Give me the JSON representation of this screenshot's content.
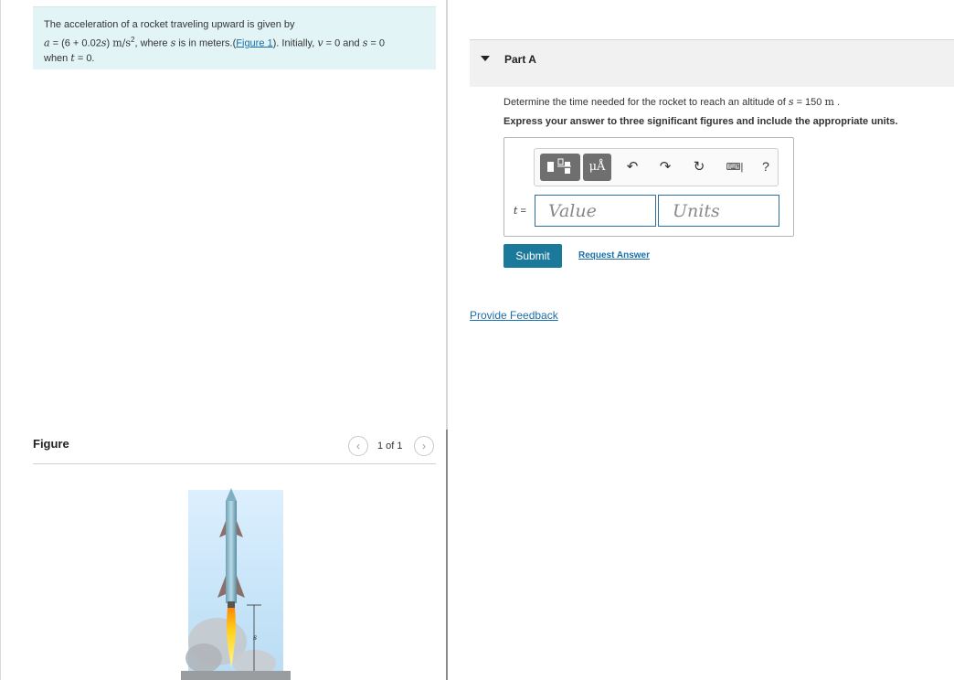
{
  "problem": {
    "line1": "The acceleration of a rocket traveling upward is given by",
    "eq_a": "a",
    "eq_expr": " = (6 + 0.02",
    "eq_s": "s",
    "eq_close": ") ",
    "eq_unit": "m/s",
    "eq_exp": "2",
    "where_text": ", where ",
    "where_s": "s",
    "where_rest": " is in meters.(",
    "figure_link": "Figure 1",
    "initially": "). Initially, ",
    "v": "v",
    "v_eq": " = 0 and ",
    "s2": "s",
    "s_eq": " = 0",
    "when_text": "when ",
    "t": "t",
    "t_eq": " = 0."
  },
  "figure": {
    "title": "Figure",
    "prev_icon": "chevron-left-icon",
    "next_icon": "chevron-right-icon",
    "pager": "1 of 1",
    "label_s": "s"
  },
  "part": {
    "title": "Part A",
    "caret_icon": "caret-down-icon"
  },
  "question": {
    "text": "Determine the time needed for the rocket to reach an altitude of ",
    "s": "s",
    "eq": " = 150  ",
    "unit": "m",
    "end": " .",
    "instruction": "Express your answer to three significant figures and include the appropriate units."
  },
  "answer": {
    "t_label": "t",
    "t_eq": " =",
    "value_placeholder": "Value",
    "units_placeholder": "Units",
    "mu_label": "μÅ",
    "help_label": "?"
  },
  "actions": {
    "submit": "Submit",
    "request": "Request Answer",
    "feedback": "Provide Feedback"
  },
  "colors": {
    "accent": "#1b7a9c",
    "link": "#1a6fa8",
    "problem_bg": "#e2f4f6"
  }
}
